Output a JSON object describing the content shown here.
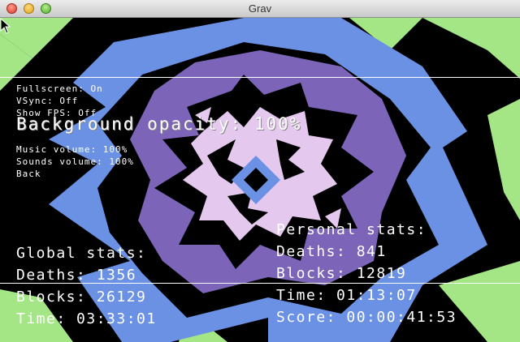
{
  "window": {
    "title": "Grav"
  },
  "menu": {
    "items": [
      {
        "label": "Fullscreen: On"
      },
      {
        "label": "VSync: Off"
      },
      {
        "label": "Show FPS: Off"
      },
      {
        "label": "Background opacity: 100%"
      },
      {
        "label": "Music volume: 100%"
      },
      {
        "label": "Sounds volume: 100%"
      },
      {
        "label": "Back"
      }
    ],
    "selected_index": 3
  },
  "global_stats": {
    "heading": "Global stats:",
    "deaths": "Deaths: 1356",
    "blocks": "Blocks: 26129",
    "time": "Time: 03:33:01"
  },
  "personal_stats": {
    "heading": "Personal stats:",
    "deaths": "Deaths: 841",
    "blocks": "Blocks: 12819",
    "time": "Time: 01:13:07",
    "score": "Score: 00:00:41:53"
  },
  "colors": {
    "green": "#a4e686",
    "blue": "#6b91e4",
    "purple": "#7c65b8",
    "lavender": "#e4c8ee",
    "background": "#000000"
  }
}
